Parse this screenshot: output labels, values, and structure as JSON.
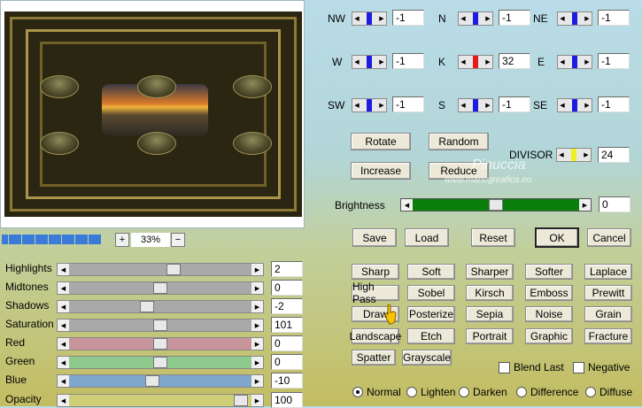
{
  "zoom": {
    "value": "33%",
    "plus": "+",
    "minus": "−"
  },
  "directions": [
    {
      "label": "NW",
      "value": "-1"
    },
    {
      "label": "N",
      "value": "-1"
    },
    {
      "label": "NE",
      "value": "-1"
    },
    {
      "label": "W",
      "value": "-1"
    },
    {
      "label": "K",
      "value": "32"
    },
    {
      "label": "E",
      "value": "-1"
    },
    {
      "label": "SW",
      "value": "-1"
    },
    {
      "label": "S",
      "value": "-1"
    },
    {
      "label": "SE",
      "value": "-1"
    }
  ],
  "divisor": {
    "label": "DIVISOR",
    "value": "24"
  },
  "buttons": {
    "rotate": "Rotate",
    "random": "Random",
    "increase": "Increase",
    "reduce": "Reduce"
  },
  "brightness": {
    "label": "Brightness",
    "value": "0",
    "level": 0.5
  },
  "dialog": {
    "save": "Save",
    "load": "Load",
    "reset": "Reset",
    "ok": "OK",
    "cancel": "Cancel"
  },
  "presets": [
    "Sharp",
    "Soft",
    "Sharper",
    "Softer",
    "Laplace",
    "High Pass",
    "Sobel",
    "Kirsch",
    "Emboss",
    "Prewitt",
    "Draw",
    "Posterize",
    "Sepia",
    "Noise",
    "Grain",
    "Landscape",
    "Etch",
    "Portrait",
    "Graphic",
    "Fracture",
    "Spatter",
    "Grayscale"
  ],
  "options": {
    "blend_last": "Blend Last",
    "negative": "Negative"
  },
  "modes": [
    "Normal",
    "Lighten",
    "Darken",
    "Difference",
    "Diffuse"
  ],
  "sliders": [
    {
      "label": "Highlights",
      "value": "2",
      "color": "#a9a9a9",
      "pos": 0.58
    },
    {
      "label": "Midtones",
      "value": "0",
      "color": "#a9a9a9",
      "pos": 0.5
    },
    {
      "label": "Shadows",
      "value": "-2",
      "color": "#a9a9a9",
      "pos": 0.42
    },
    {
      "label": "Saturation",
      "value": "101",
      "color": "#a9a9a9",
      "pos": 0.5
    },
    {
      "label": "Red",
      "value": "0",
      "color": "#c8949c",
      "pos": 0.5
    },
    {
      "label": "Green",
      "value": "0",
      "color": "#8ec98e",
      "pos": 0.5
    },
    {
      "label": "Blue",
      "value": "-10",
      "color": "#7fa7cc",
      "pos": 0.45
    },
    {
      "label": "Opacity",
      "value": "100",
      "color": "#cfcd76",
      "pos": 0.98
    }
  ],
  "watermark": {
    "line1": "Pinuccia",
    "line2": "www.mariogreafica.eu"
  }
}
